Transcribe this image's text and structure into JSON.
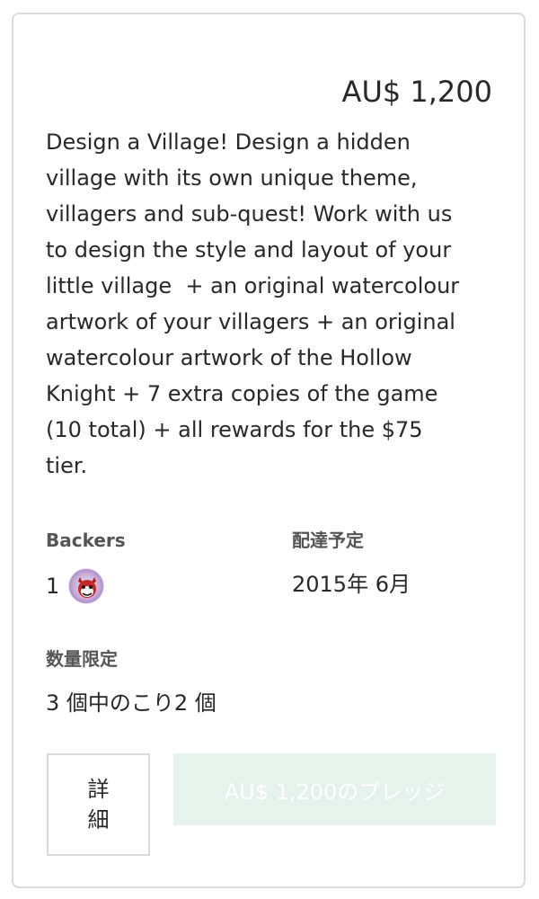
{
  "reward": {
    "amount": "AU$ 1,200",
    "description": "Design a Village! Design a hidden\nvillage with its own unique theme,\nvillagers and sub-quest! Work with us\nto design the style and layout of your\nlittle village  + an original watercolour\nartwork of your villagers + an original\nwatercolour artwork of the Hollow\nKnight + 7 extra copies of the game\n(10 total) + all rewards for the $75\ntier."
  },
  "stats": {
    "backers_label": "Backers",
    "backers_count": "1",
    "delivery_label": "配達予定",
    "delivery_value": "2015年 6月",
    "limited_label": "数量限定",
    "limited_value": "3 個中のこり2 個"
  },
  "actions": {
    "details_label": "詳細",
    "pledge_label": "AU$ 1,200のプレッジ"
  },
  "colors": {
    "border": "#dcdcdc",
    "pledge_button_bg": "#e6f2ec",
    "text": "#282828",
    "label": "#555555"
  }
}
